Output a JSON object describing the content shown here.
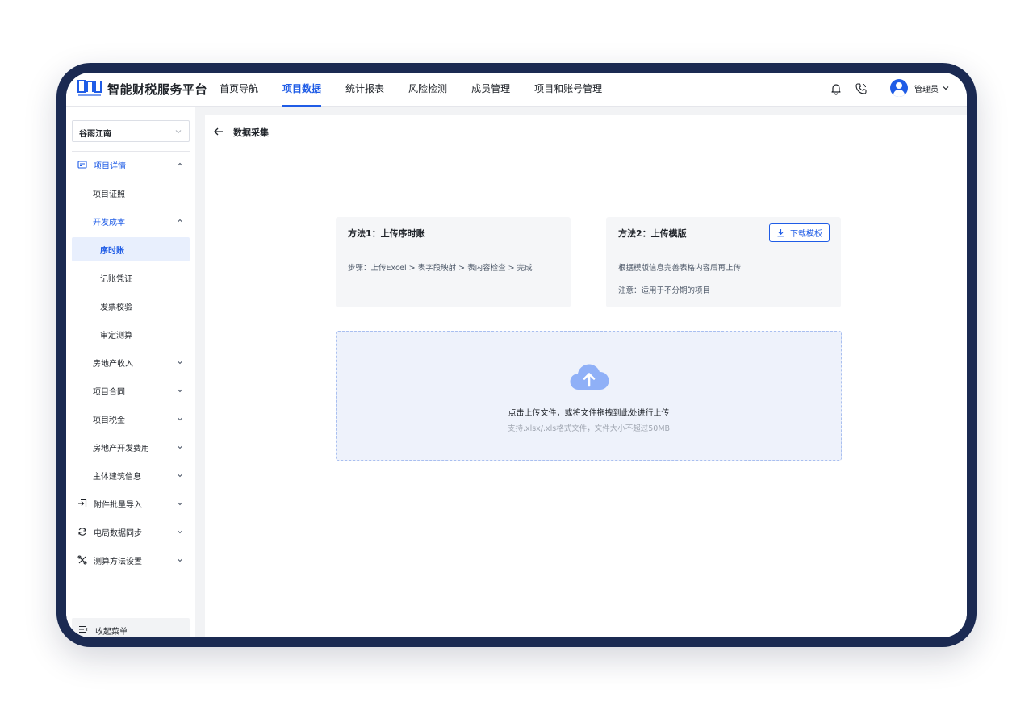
{
  "app": {
    "brand": "智能财税服务平台"
  },
  "nav": {
    "items": [
      {
        "label": "首页导航",
        "active": false
      },
      {
        "label": "项目数据",
        "active": true
      },
      {
        "label": "统计报表",
        "active": false
      },
      {
        "label": "风险检测",
        "active": false
      },
      {
        "label": "成员管理",
        "active": false
      },
      {
        "label": "项目和账号管理",
        "active": false
      }
    ]
  },
  "user": {
    "name": "管理员"
  },
  "sidebar": {
    "project": "谷雨江南",
    "items": [
      {
        "label": "项目详情",
        "icon": "project-detail-icon",
        "expanded": true
      },
      {
        "label": "项目证照"
      },
      {
        "label": "开发成本",
        "expanded": true
      },
      {
        "label": "序时账",
        "selected": true
      },
      {
        "label": "记账凭证"
      },
      {
        "label": "发票校验"
      },
      {
        "label": "审定测算"
      },
      {
        "label": "房地产收入"
      },
      {
        "label": "项目合同"
      },
      {
        "label": "项目税金"
      },
      {
        "label": "房地产开发费用"
      },
      {
        "label": "主体建筑信息"
      },
      {
        "label": "附件批量导入",
        "icon": "import-icon"
      },
      {
        "label": "电局数据同步",
        "icon": "sync-icon"
      },
      {
        "label": "测算方法设置",
        "icon": "tools-icon"
      }
    ],
    "collapse_label": "收起菜单"
  },
  "main": {
    "title": "数据采集",
    "method1": {
      "title": "方法1：上传序时账",
      "steps": "步骤：上传Excel > 表字段映射 > 表内容检查 > 完成"
    },
    "method2": {
      "title": "方法2：上传模版",
      "download_label": "下载模板",
      "line1": "根据模版信息完善表格内容后再上传",
      "line2": "注意：适用于不分期的项目"
    },
    "upload": {
      "main_text": "点击上传文件，或将文件拖拽到此处进行上传",
      "hint": "支持.xlsx/.xls格式文件，文件大小不超过50MB"
    }
  },
  "colors": {
    "accent": "#1f5ce6",
    "frame": "#1b2a52",
    "upload_bg": "#eef2fb"
  }
}
